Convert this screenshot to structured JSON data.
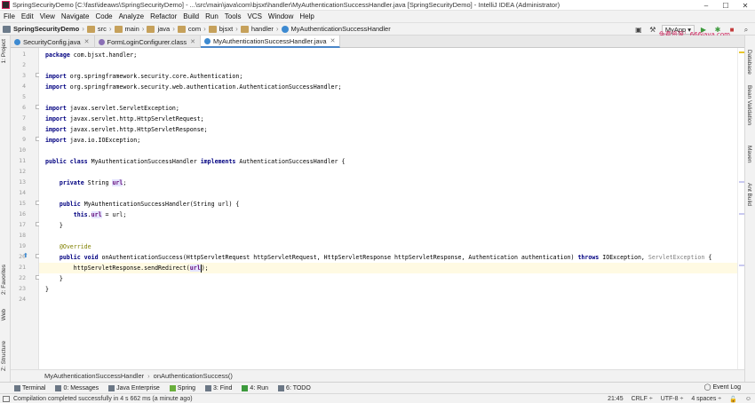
{
  "window": {
    "title": "SpringSecurityDemo [C:\\fast\\ideaws\\SpringSecurityDemo] - ...\\src\\main\\java\\com\\bjsxt\\handler\\MyAuthenticationSuccessHandler.java [SpringSecurityDemo] - IntelliJ IDEA (Administrator)",
    "controls": [
      "–",
      "☐",
      "✕"
    ]
  },
  "menu": [
    "File",
    "Edit",
    "View",
    "Navigate",
    "Code",
    "Analyze",
    "Refactor",
    "Build",
    "Run",
    "Tools",
    "VCS",
    "Window",
    "Help"
  ],
  "navbar": {
    "crumbs": [
      "SpringSecurityDemo",
      "src",
      "main",
      "java",
      "com",
      "bjsxt",
      "handler",
      "MyAuthenticationSuccessHandler"
    ],
    "run_config": "MyApp",
    "watermark": "免费资源：666java.com"
  },
  "tabs": [
    {
      "label": "SecurityConfig.java",
      "active": false
    },
    {
      "label": "FormLoginConfigurer.class",
      "active": false
    },
    {
      "label": "MyAuthenticationSuccessHandler.java",
      "active": true
    }
  ],
  "left_tools": [
    "1: Project",
    "2: Favorites",
    "Web",
    "Z: Structure"
  ],
  "right_tools": [
    "Database",
    "Bean Validation",
    "Maven",
    "Ant Build"
  ],
  "editor": {
    "line_numbers": [
      "1",
      "2",
      "3",
      "4",
      "5",
      "6",
      "7",
      "8",
      "9",
      "10",
      "11",
      "12",
      "13",
      "14",
      "15",
      "16",
      "17",
      "18",
      "19",
      "20",
      "21",
      "22",
      "23",
      "24"
    ],
    "code": {
      "l1": "package com.bjsxt.handler;",
      "l3": "import org.springframework.security.core.Authentication;",
      "l4": "import org.springframework.security.web.authentication.AuthenticationSuccessHandler;",
      "l6": "import javax.servlet.ServletException;",
      "l7": "import javax.servlet.http.HttpServletRequest;",
      "l8": "import javax.servlet.http.HttpServletResponse;",
      "l9": "import java.io.IOException;",
      "l11": "public class MyAuthenticationSuccessHandler implements AuthenticationSuccessHandler {",
      "l13": "    private String url;",
      "l15": "    public MyAuthenticationSuccessHandler(String url) {",
      "l16": "        this.url = url;",
      "l17": "    }",
      "l19": "    @Override",
      "l20": "    public void onAuthenticationSuccess(HttpServletRequest httpServletRequest, HttpServletResponse httpServletResponse, Authentication authentication) throws IOException, ServletException {",
      "l21": "        httpServletResponse.sendRedirect(url);",
      "l22": "    }",
      "l23": "}"
    }
  },
  "editor_breadcrumb": [
    "MyAuthenticationSuccessHandler",
    "onAuthenticationSuccess()"
  ],
  "tool_windows": [
    "Terminal",
    "0: Messages",
    "Java Enterprise",
    "Spring",
    "3: Find",
    "4: Run",
    "6: TODO"
  ],
  "event_log": "Event Log",
  "status": {
    "message": "Compilation completed successfully in 4 s 662 ms (a minute ago)",
    "position": "21:45",
    "line_sep": "CRLF ÷",
    "encoding": "UTF-8 ÷",
    "indent": "4 spaces ÷"
  }
}
